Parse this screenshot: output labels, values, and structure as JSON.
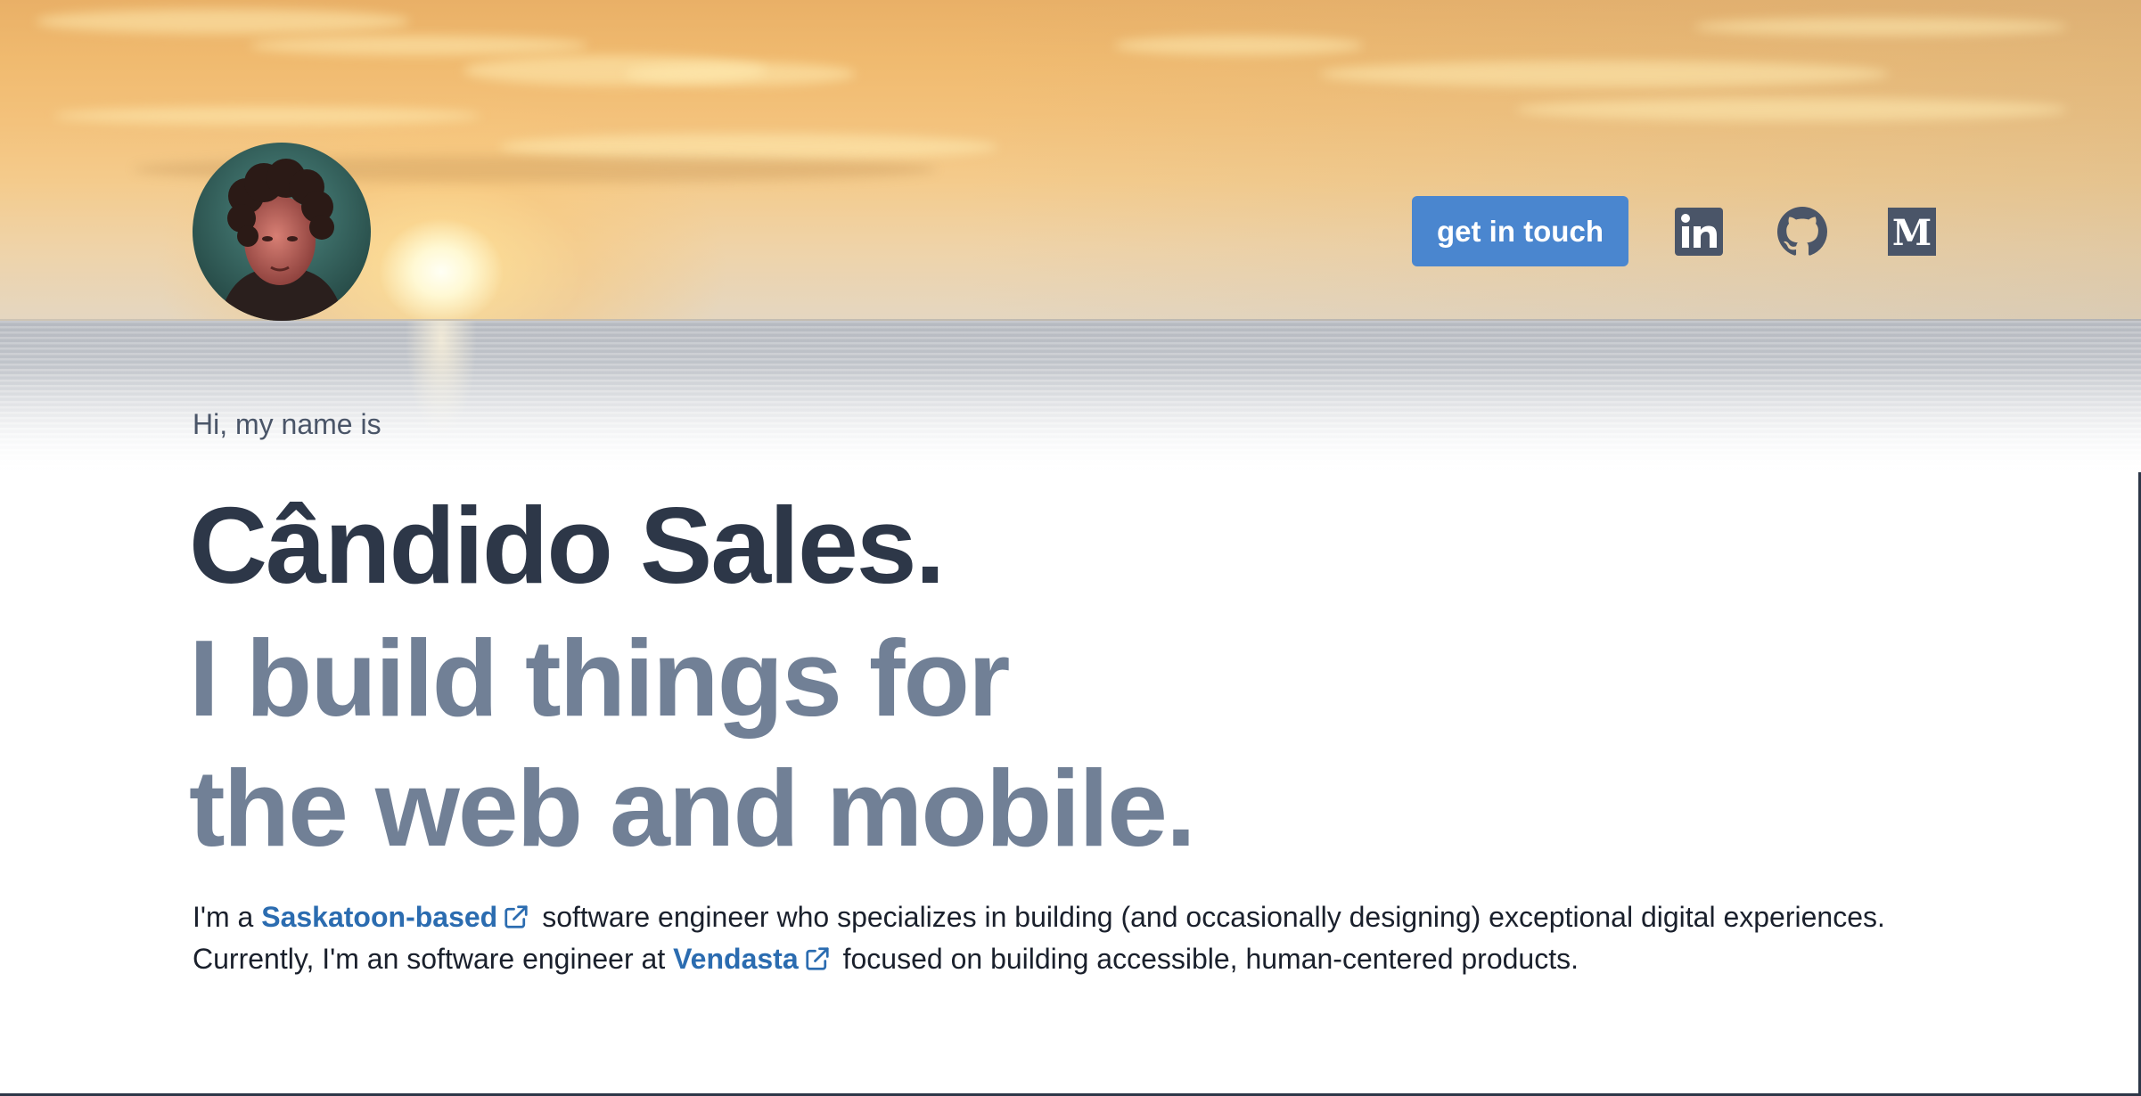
{
  "header": {
    "avatar_alt": "profile photo",
    "cta_label": "get in touch",
    "social": [
      {
        "icon": "linkedin-icon",
        "label": "LinkedIn"
      },
      {
        "icon": "github-icon",
        "label": "GitHub"
      },
      {
        "icon": "medium-icon",
        "label": "Medium"
      }
    ]
  },
  "intro": {
    "greeting": "Hi, my name is",
    "name": "Cândido Sales.",
    "tagline_line1": "I build things for",
    "tagline_line2": "the web and mobile."
  },
  "bio": {
    "line1_prefix": "I'm a",
    "line1_link": "Saskatoon-based",
    "line1_suffix": "software engineer who specializes in building (and occasionally designing) exceptional digital experiences.",
    "line2_prefix": "Currently, I'm an software engineer at",
    "line2_link": "Vendasta",
    "line2_suffix": "focused on building accessible, human-centered products."
  },
  "colors": {
    "accent": "#4a86cf",
    "link": "#2b6cb0",
    "heading": "#2d3748",
    "subheading": "#718096",
    "icon": "#4a5568"
  }
}
